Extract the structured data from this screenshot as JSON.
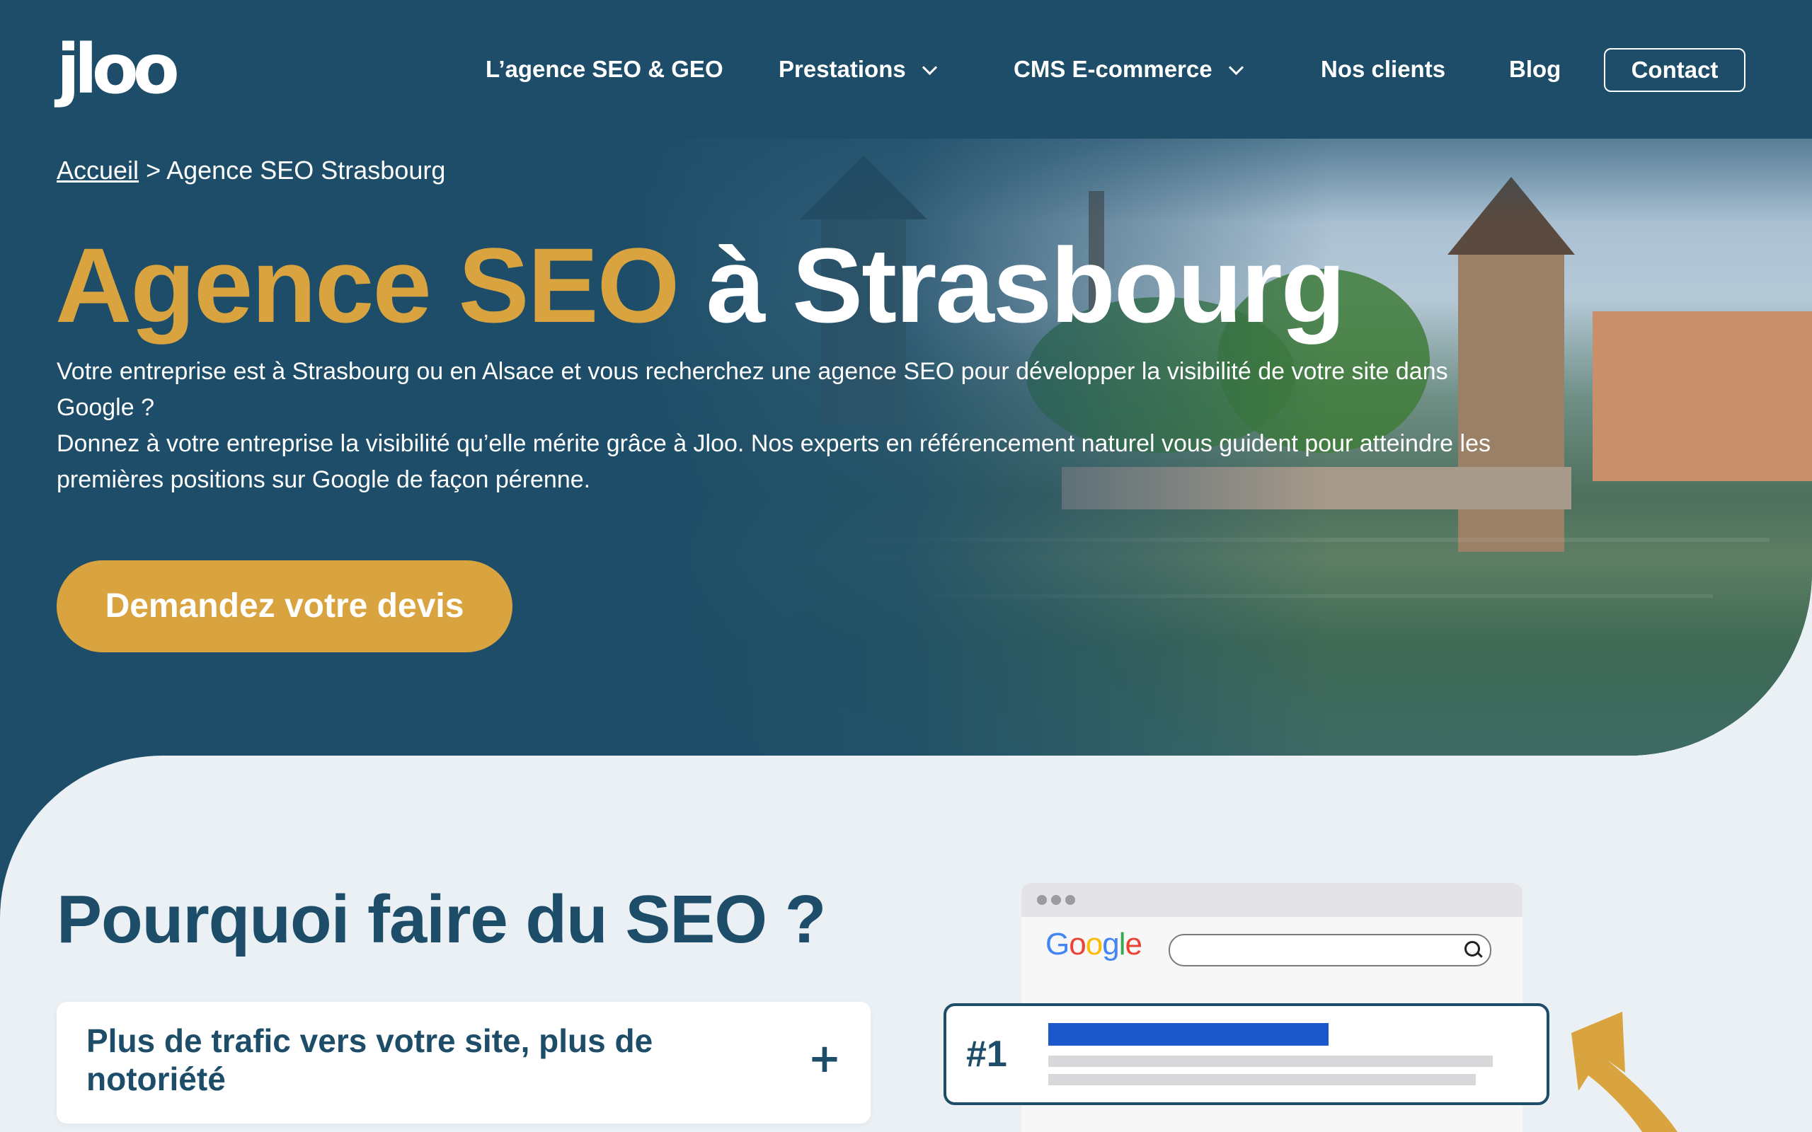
{
  "header": {
    "logo_text": "jloo",
    "nav": [
      {
        "label": "L’agence SEO & GEO",
        "has_dropdown": false
      },
      {
        "label": "Prestations",
        "has_dropdown": true
      },
      {
        "label": "CMS E-commerce",
        "has_dropdown": true
      },
      {
        "label": "Nos clients",
        "has_dropdown": false
      },
      {
        "label": "Blog",
        "has_dropdown": false
      }
    ],
    "contact_label": "Contact"
  },
  "breadcrumb": {
    "home": "Accueil",
    "separator": ">",
    "current": "Agence SEO Strasbourg"
  },
  "hero": {
    "title_highlight": "Agence SEO",
    "title_rest": "à Strasbourg",
    "paragraph_1": "Votre entreprise est à Strasbourg ou en Alsace et vous recherchez une agence SEO pour développer la visibilité de votre site dans Google ?",
    "paragraph_2": "Donnez à votre entreprise la visibilité qu’elle mérite grâce à Jloo. Nos experts en référencement naturel vous guident pour atteindre les premières positions sur Google de façon pérenne.",
    "cta_label": "Demandez votre devis"
  },
  "section": {
    "heading": "Pourquoi faire du SEO ?",
    "accordion": [
      {
        "title": "Plus de trafic vers votre site, plus de notoriété",
        "toggle": "+"
      }
    ]
  },
  "illustration": {
    "google_label": "Google",
    "rank_label": "#1"
  },
  "colors": {
    "primary": "#1d4d68",
    "accent": "#d9a43f",
    "background": "#eaf0f4",
    "google_blue": "#4285F4",
    "google_red": "#EA4335",
    "google_yellow": "#FBBC05",
    "google_green": "#34A853",
    "result_bar": "#1c57cc"
  }
}
